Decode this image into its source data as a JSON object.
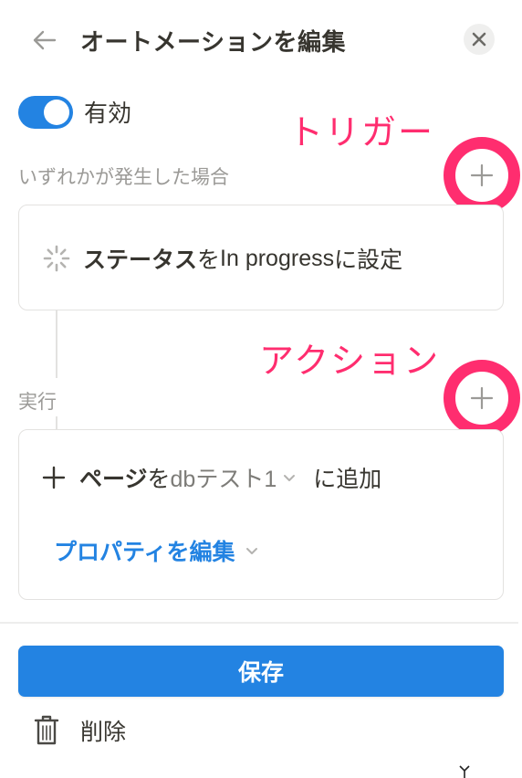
{
  "header": {
    "back_icon": "arrow-left-icon",
    "title": "オートメーションを編集",
    "close_icon": "close-icon"
  },
  "toggle": {
    "label": "有効",
    "on": true
  },
  "annotations": {
    "trigger": "トリガー",
    "action": "アクション",
    "color": "#ff2d6f"
  },
  "trigger_section": {
    "label": "いずれかが発生した場合",
    "add_icon": "plus-icon",
    "item": {
      "icon": "status-in-progress-icon",
      "bold_text": "ステータス",
      "text_part1": "を",
      "value": "In progress",
      "text_part2": "に設定"
    }
  },
  "action_section": {
    "label": "実行",
    "add_icon": "plus-icon",
    "item": {
      "icon": "plus-icon",
      "bold_text": "ページ",
      "text_part1": "を",
      "database": "dbテスト1",
      "text_part2": "に追加",
      "edit_properties_label": "プロパティを編集"
    }
  },
  "footer": {
    "save_label": "保存",
    "delete_label": "削除",
    "delete_icon": "trash-icon"
  },
  "colors": {
    "accent": "#2383e2",
    "text": "#37352f",
    "muted": "#9b9a97"
  }
}
